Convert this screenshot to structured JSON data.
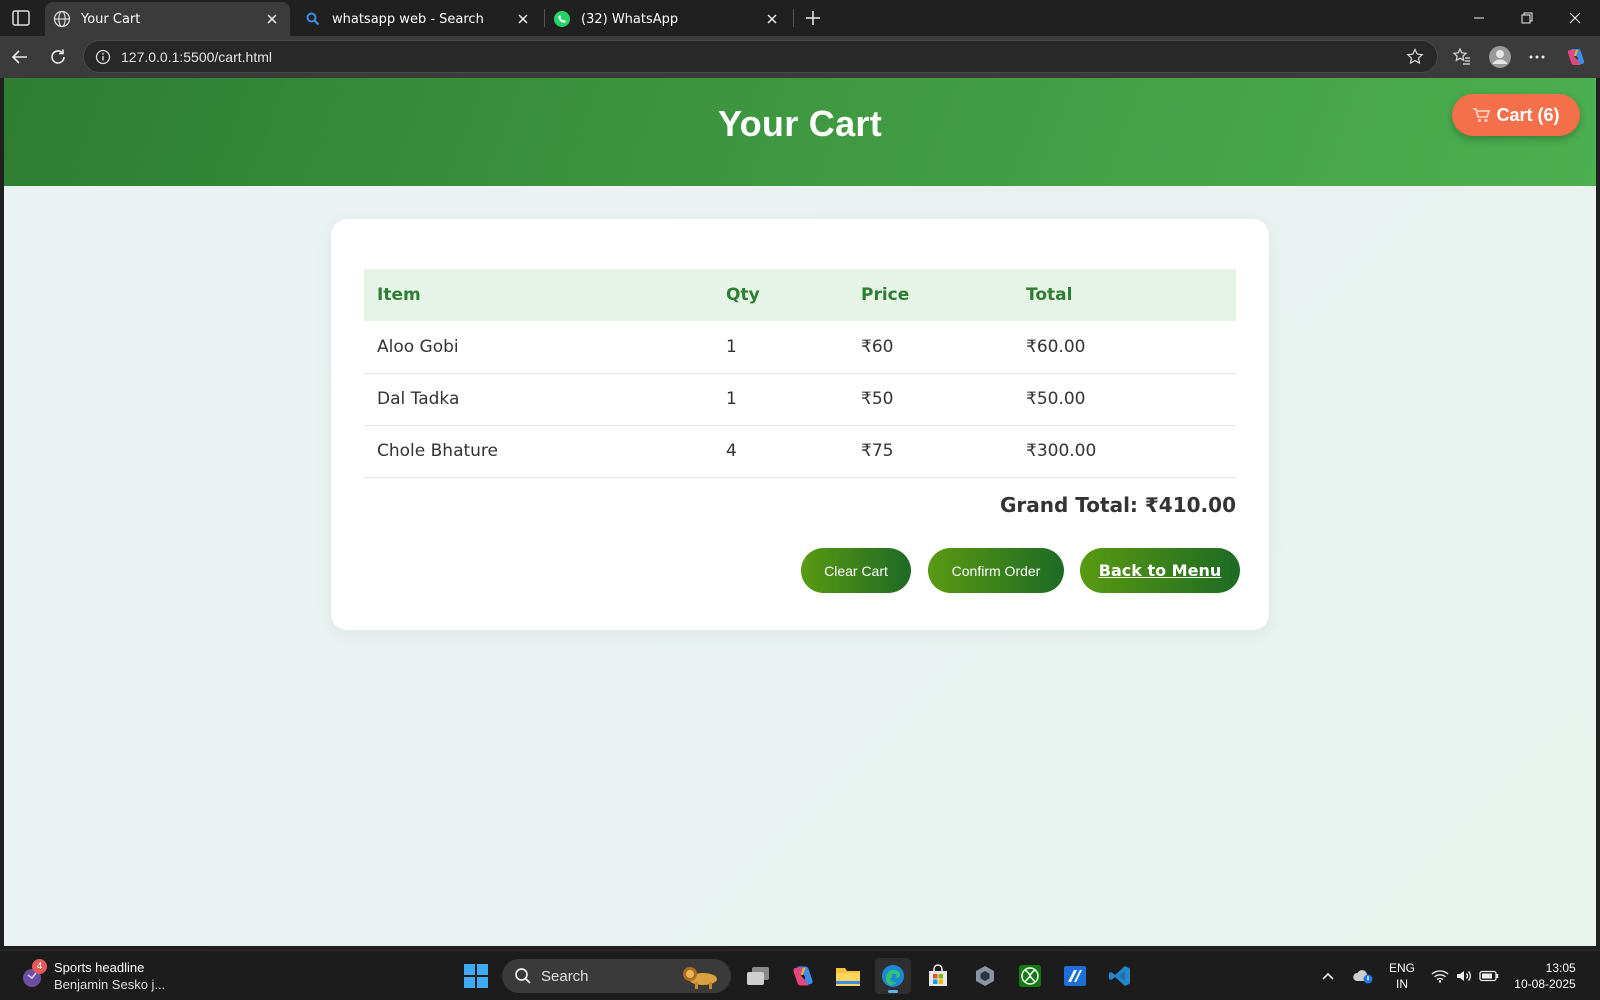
{
  "browser": {
    "tabs": [
      {
        "title": "Your Cart",
        "favicon": "globe-icon",
        "active": true
      },
      {
        "title": "whatsapp web - Search",
        "favicon": "search-icon",
        "active": false
      },
      {
        "title": "(32) WhatsApp",
        "favicon": "whatsapp-icon",
        "active": false
      }
    ],
    "url": "127.0.0.1:5500/cart.html"
  },
  "page": {
    "header_title": "Your Cart",
    "cart_button": "Cart (6)",
    "table": {
      "headers": [
        "Item",
        "Qty",
        "Price",
        "Total"
      ],
      "rows": [
        [
          "Aloo Gobi",
          "1",
          "₹60",
          "₹60.00"
        ],
        [
          "Dal Tadka",
          "1",
          "₹50",
          "₹50.00"
        ],
        [
          "Chole Bhature",
          "4",
          "₹75",
          "₹300.00"
        ]
      ]
    },
    "grand_total": "Grand Total: ₹410.00",
    "buttons": {
      "clear": "Clear Cart",
      "confirm": "Confirm Order",
      "back": "Back to Menu"
    }
  },
  "colors": {
    "header_green": "#2e7d32",
    "cart_pill": "#f4704a",
    "button_gradient_start": "#5a9a12",
    "button_gradient_end": "#1d6a24"
  },
  "taskbar": {
    "widget_title": "Sports headline",
    "widget_sub": "Benjamin Sesko j...",
    "widget_badge": "4",
    "search_label": "Search",
    "lang_top": "ENG",
    "lang_bottom": "IN",
    "time": "13:05",
    "date": "10-08-2025"
  }
}
